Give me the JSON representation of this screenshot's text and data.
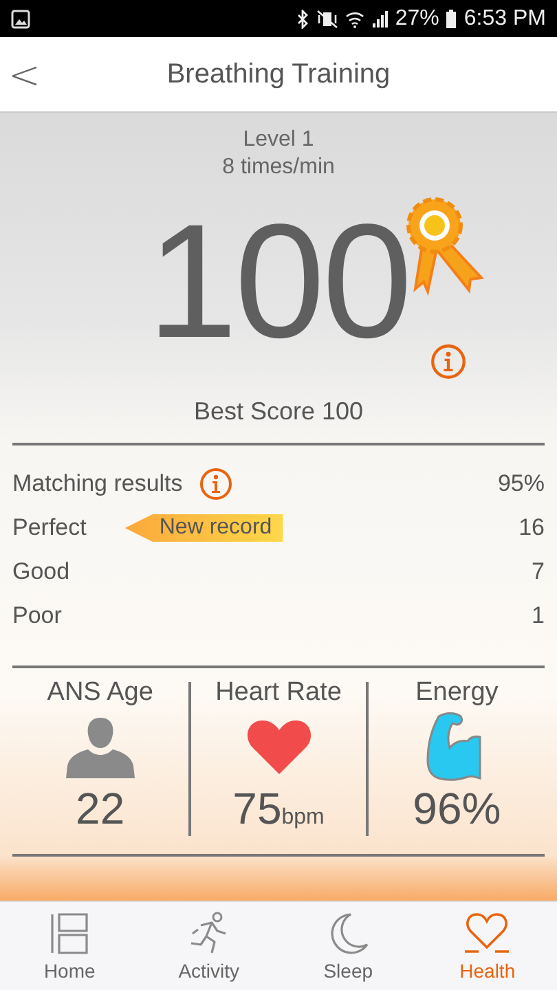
{
  "status_bar": {
    "battery": "27%",
    "time": "6:53 PM"
  },
  "header": {
    "back": "<",
    "title": "Breathing Training"
  },
  "score": {
    "level": "Level 1",
    "rate": "8 times/min",
    "value": "100",
    "best": "Best Score 100"
  },
  "results": [
    {
      "label": "Matching results",
      "info": true,
      "value": "95%"
    },
    {
      "label": "Perfect",
      "info": false,
      "badge": "New record",
      "value": "16"
    },
    {
      "label": "Good",
      "info": false,
      "value": "7"
    },
    {
      "label": "Poor",
      "info": false,
      "value": "1"
    }
  ],
  "metrics": [
    {
      "label": "ANS Age",
      "kind": "person",
      "value": "22"
    },
    {
      "label": "Heart Rate",
      "kind": "heart",
      "value": "75",
      "unit": "bpm"
    },
    {
      "label": "Energy",
      "kind": "muscle",
      "value": "96%"
    }
  ],
  "tabs": [
    {
      "label": "Home",
      "kind": "home",
      "selected": false
    },
    {
      "label": "Activity",
      "kind": "activity",
      "selected": false
    },
    {
      "label": "Sleep",
      "kind": "sleep",
      "selected": false
    },
    {
      "label": "Health",
      "kind": "health",
      "selected": true
    }
  ]
}
